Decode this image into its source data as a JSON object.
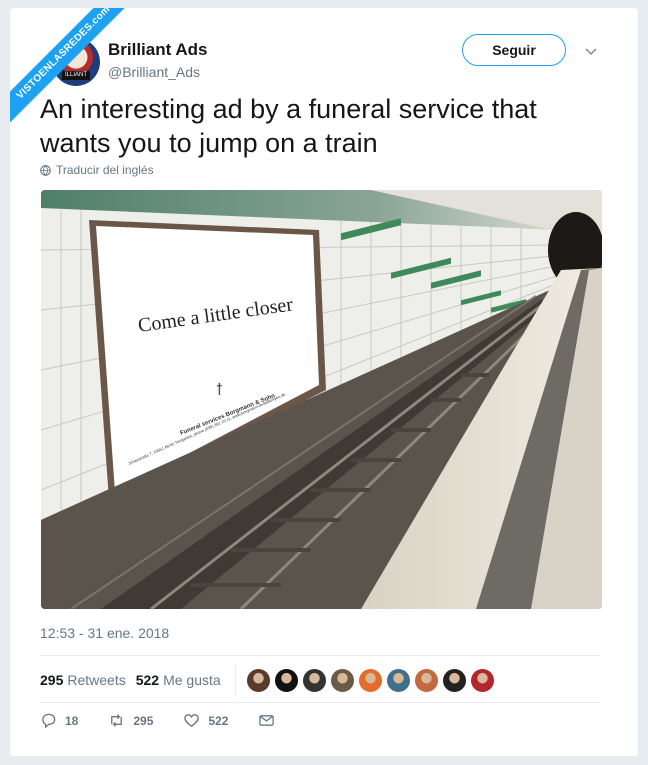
{
  "watermark": {
    "text": "VISTOENLASREDES",
    "sub": ".com",
    "color": "#1da1f2"
  },
  "author": {
    "name": "Brilliant Ads",
    "handle": "@Brilliant_Ads",
    "avatar_icon": "uncle-sam-avatar",
    "avatar_tag": "ILLIANT"
  },
  "follow_button": {
    "label": "Seguir"
  },
  "more_icon": "chevron-down-icon",
  "tweet": {
    "text": "An interesting ad by a funeral service that wants you to jump on a train",
    "translate_label": "Traducir del inglés"
  },
  "photo": {
    "ad_headline": "Come a little closer",
    "ad_company": "Funeral services Borgmann & Sohn",
    "ad_address": "Jonasstraße 7, 10551 Berlin Tiergarten, phone (030) 391 10 11, www.borgmann-bestattungen.de"
  },
  "timestamp": "12:53 - 31 ene. 2018",
  "stats": {
    "retweets_count": "295",
    "retweets_label": "Retweets",
    "likes_count": "522",
    "likes_label": "Me gusta",
    "liker_avatars": [
      "#5a3a2a",
      "#111111",
      "#333333",
      "#6b5a45",
      "#e36b2c",
      "#3f6f8a",
      "#c2693f",
      "#222222",
      "#b3262b"
    ]
  },
  "actions": {
    "reply_count": "18",
    "retweet_count": "295",
    "like_count": "522"
  },
  "colors": {
    "accent": "#1da1f2",
    "secondary_text": "#657786"
  }
}
